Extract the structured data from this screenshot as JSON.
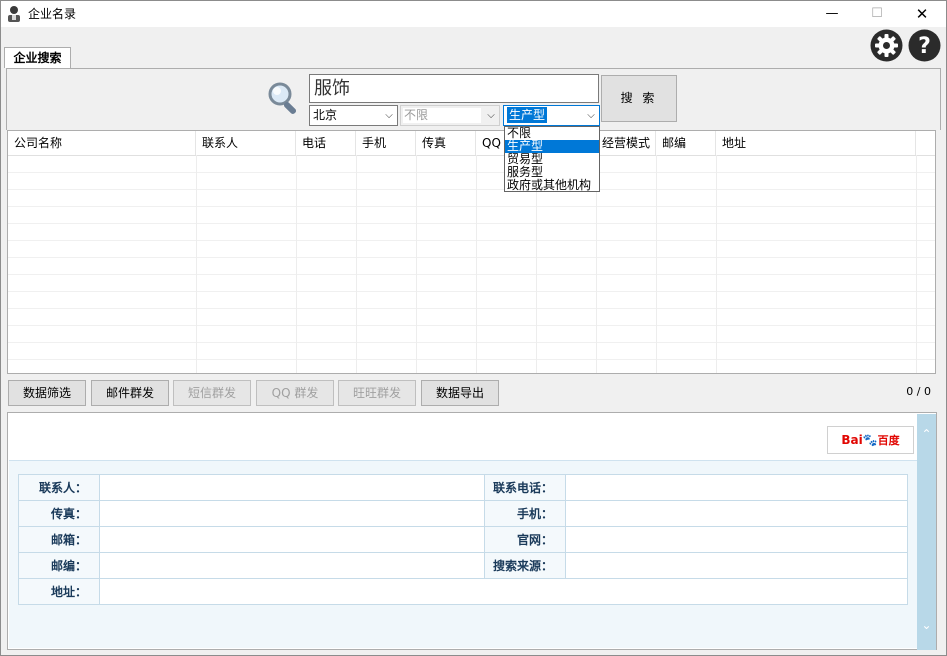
{
  "window": {
    "title": "企业名录",
    "controls": {
      "minimize": "—",
      "maximize": "☐",
      "close": "✕"
    }
  },
  "tabs": [
    {
      "label": "企业搜索",
      "active": true
    }
  ],
  "toolbar_icons": {
    "settings": "gear-icon",
    "help": "help-icon"
  },
  "search": {
    "keyword": "服饰",
    "city": "北京",
    "district": "不限",
    "type": "生产型",
    "button_label": "搜 索",
    "type_options": [
      "不限",
      "生产型",
      "贸易型",
      "服务型",
      "政府或其他机构"
    ],
    "type_selected_index": 1
  },
  "grid": {
    "columns": [
      "公司名称",
      "联系人",
      "电话",
      "手机",
      "传真",
      "QQ",
      "",
      "经营模式",
      "邮编",
      "地址"
    ]
  },
  "actions": {
    "filter": "数据筛选",
    "mail": "邮件群发",
    "sms": "短信群发",
    "qq": "QQ 群发",
    "wangwang": "旺旺群发",
    "export": "数据导出",
    "record_count": "0 / 0"
  },
  "detail": {
    "baidu_label_1": "Bai",
    "baidu_label_2": "百度",
    "fields": {
      "contact": "联系人：",
      "contact_phone": "联系电话：",
      "fax": "传真：",
      "mobile": "手机：",
      "email": "邮箱：",
      "website": "官网：",
      "postcode": "邮编：",
      "source": "搜索来源：",
      "address": "地址："
    }
  },
  "colors": {
    "accent": "#0078d7",
    "detail_bg": "#f0f7fb",
    "scrollbar": "#b8d8e8"
  }
}
